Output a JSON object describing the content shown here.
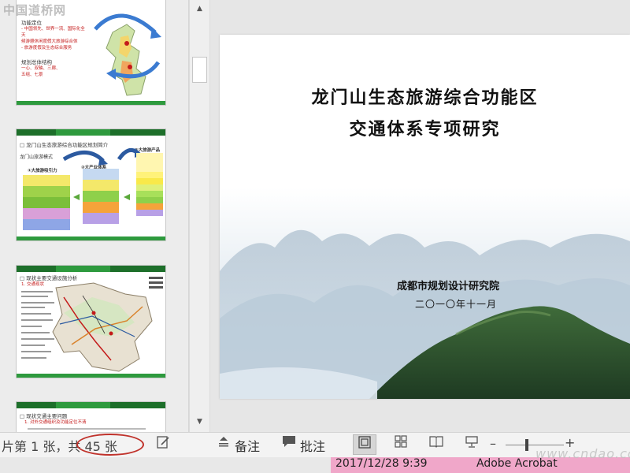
{
  "watermark": "中国道桥网",
  "slide": {
    "title_line1": "龙门山生态旅游综合功能区",
    "title_line2": "交通体系专项研究",
    "organization": "成都市规划设计研究院",
    "date": "二〇一〇年十一月"
  },
  "thumbnails": {
    "t1": {
      "l1": "功能定位",
      "red1": "- 中国领先、世界一流、国际化全天",
      "red2": "  候游憩休闲度假大旅游综合体",
      "red3": "- 旅游度假及生态综合服务",
      "l2": "规划总体结构",
      "red4": "一心、双轴、三廊、",
      "red5": "五组、七景"
    },
    "t2": {
      "title": "□ 龙门山生态旅游综合功能区规划简介",
      "sub": "龙门山旅游模式",
      "box1": "①大旅游吸引力",
      "box2": "②大产业体系",
      "box3": "③大旅游产品"
    },
    "t3": {
      "title": "□ 现状主要交通设施分析",
      "subtitle": "1. 交通现状"
    },
    "t4": {
      "title": "□ 现状交通主要问题",
      "item": "1. 对外交通组织及功能定位不清"
    }
  },
  "status": {
    "slide_info_pre": "片第 1 张，",
    "slide_info_total": "共 45 张",
    "notes_label": "备注",
    "comments_label": "批注"
  },
  "taskbar": {
    "datetime": "2017/12/28 9:39",
    "app": "Adobe Acrobat",
    "site": "www.cndao.com"
  },
  "colors": {
    "accent_green": "#2e9a3e",
    "circle_red": "#c0322b",
    "taskbar_pink": "#f0a7c9"
  }
}
